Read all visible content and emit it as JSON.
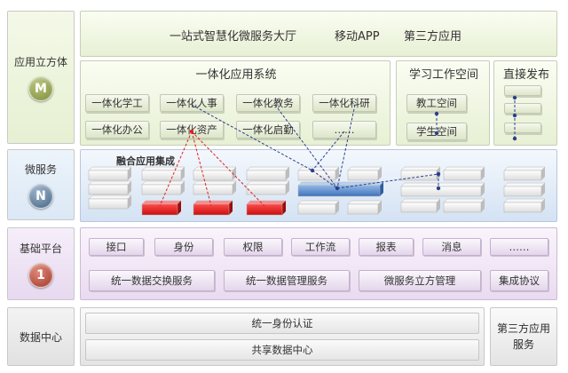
{
  "layers": {
    "application": {
      "label": "应用立方体",
      "badge": "M",
      "badge_color": "#8a9a4c"
    },
    "microservice": {
      "label": "微服务",
      "badge": "N",
      "badge_color": "#4f6f8f"
    },
    "platform": {
      "label": "基础平台",
      "badge": "1",
      "badge_color": "#b24a3c"
    },
    "data": {
      "label": "数据中心"
    }
  },
  "top_bar": {
    "items": [
      "一站式智慧化微服务大厅",
      "移动APP",
      "第三方应用"
    ]
  },
  "integrated_system": {
    "title": "一体化应用系统",
    "modules": [
      "一体化学工",
      "一体化人事",
      "一体化教务",
      "一体化科研",
      "一体化办公",
      "一体化资产",
      "一体化启勤",
      "……"
    ]
  },
  "study_workspace": {
    "title": "学习工作空间",
    "items": [
      "教工空间",
      "学生空间"
    ]
  },
  "direct_publish": {
    "title": "直接发布"
  },
  "integration": {
    "label": "融合应用集成"
  },
  "platform": {
    "row1": [
      "接口",
      "身份",
      "权限",
      "工作流",
      "报表",
      "消息",
      "……"
    ],
    "row2": [
      "统一数据交换服务",
      "统一数据管理服务",
      "微服务立方管理",
      "集成协议"
    ]
  },
  "data_center": {
    "items": [
      "统一身份认证",
      "共享数据中心"
    ],
    "third_party": [
      "第三方应用",
      "服务"
    ]
  },
  "colors": {
    "red_block": "#e02020",
    "blue_block": "#5b8fd0",
    "dashed_line": "#2b3f8c"
  }
}
